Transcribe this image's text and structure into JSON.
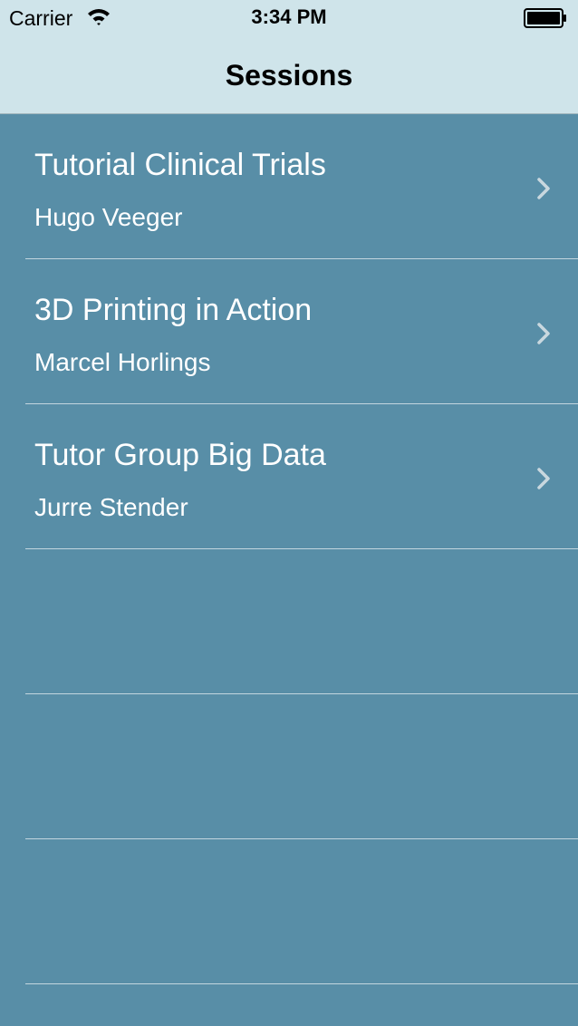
{
  "status_bar": {
    "carrier": "Carrier",
    "time": "3:34 PM",
    "wifi_icon": "wifi-icon",
    "battery_icon": "battery-icon"
  },
  "nav": {
    "title": "Sessions"
  },
  "sessions": [
    {
      "title": "Tutorial Clinical Trials",
      "speaker": "Hugo Veeger"
    },
    {
      "title": "3D Printing in Action",
      "speaker": "Marcel Horlings"
    },
    {
      "title": "Tutor Group Big Data",
      "speaker": "Jurre Stender"
    }
  ],
  "colors": {
    "nav_background": "#cfe4ea",
    "list_background": "#588ea7",
    "separator": "#c3d6df",
    "chevron": "#c9d8df",
    "text": "#ffffff"
  }
}
